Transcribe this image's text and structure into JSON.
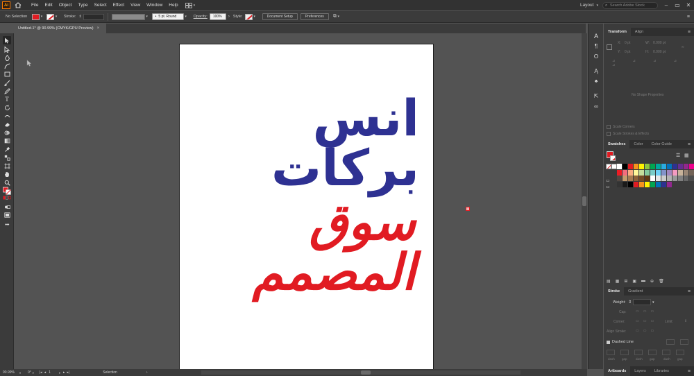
{
  "app": {
    "logo": "Ai"
  },
  "menu": [
    "File",
    "Edit",
    "Object",
    "Type",
    "Select",
    "Effect",
    "View",
    "Window",
    "Help"
  ],
  "workspace": {
    "label": "Layout",
    "search_placeholder": "Search Adobe Stock"
  },
  "control_bar": {
    "selection": "No Selection",
    "stroke_label": "Stroke:",
    "brush": "5 pt. Round",
    "opacity_label": "Opacity:",
    "opacity_value": "100%",
    "style_label": "Style:",
    "document_setup": "Document Setup",
    "preferences": "Preferences"
  },
  "document_tab": {
    "title": "Untitled-1* @ 90.99% (CMYK/GPU Preview)",
    "close": "×"
  },
  "artboard": {
    "line1": "انس بركات",
    "line2": "سوق المصمم",
    "colors": {
      "line1": "#2e3192",
      "line2": "#e11b22"
    }
  },
  "status_bar": {
    "zoom": "90.99%",
    "rotation": "0°",
    "artboard": "1",
    "tool": "Selection"
  },
  "transform_panel": {
    "tabs": [
      "Transform",
      "Align"
    ],
    "x": "X:",
    "x_value": "0 pt",
    "y": "Y:",
    "y_value": "0 pt",
    "w": "W:",
    "w_value": "0.000 pt",
    "h": "H:",
    "h_value": "0.000 pt",
    "empty": "No Shape Properties",
    "scale_corners": "Scale Corners",
    "scale_strokes": "Scale Strokes & Effects"
  },
  "swatches_panel": {
    "tabs": [
      "Swatches",
      "Color",
      "Color Guide"
    ],
    "swatches": [
      "#ffffff",
      "#000000",
      "#e11b22",
      "#f7931e",
      "#fff200",
      "#8dc63f",
      "#00a651",
      "#00a99d",
      "#29abe2",
      "#0072bc",
      "#2e3192",
      "#662d91",
      "#92278f",
      "#ec008c",
      "#ed1c24",
      "#f26d7d",
      "#f9ad81",
      "#fff799",
      "#c4df9b",
      "#82ca9c",
      "#7accc8",
      "#6dcff6",
      "#8393ca",
      "#a186be",
      "#f49ac1",
      "#c7b299",
      "#998675",
      "#736357",
      "#534741",
      "#c69c6d",
      "#a67c52",
      "#8c6239",
      "#754c24",
      "#603913",
      "#ffffff",
      "#e6e6e6",
      "#cccccc",
      "#b3b3b3",
      "#999999",
      "#808080",
      "#666666",
      "#4d4d4d",
      "#333333",
      "#1a1a1a",
      "#000000",
      "#e11b22",
      "#f7931e",
      "#fff200",
      "#00a651",
      "#0072bc",
      "#2e3192",
      "#92278f"
    ]
  },
  "stroke_panel": {
    "tabs": [
      "Stroke",
      "Gradient"
    ],
    "weight_label": "Weight:",
    "cap_label": "Cap:",
    "corner_label": "Corner:",
    "limit_label": "Limit:",
    "align_label": "Align Stroke:",
    "dashed_line": "Dashed Line",
    "dash_labels": [
      "dash",
      "gap",
      "dash",
      "gap",
      "dash",
      "gap"
    ]
  },
  "bottom_panel": {
    "tabs": [
      "Artboards",
      "Layers",
      "Libraries"
    ]
  }
}
